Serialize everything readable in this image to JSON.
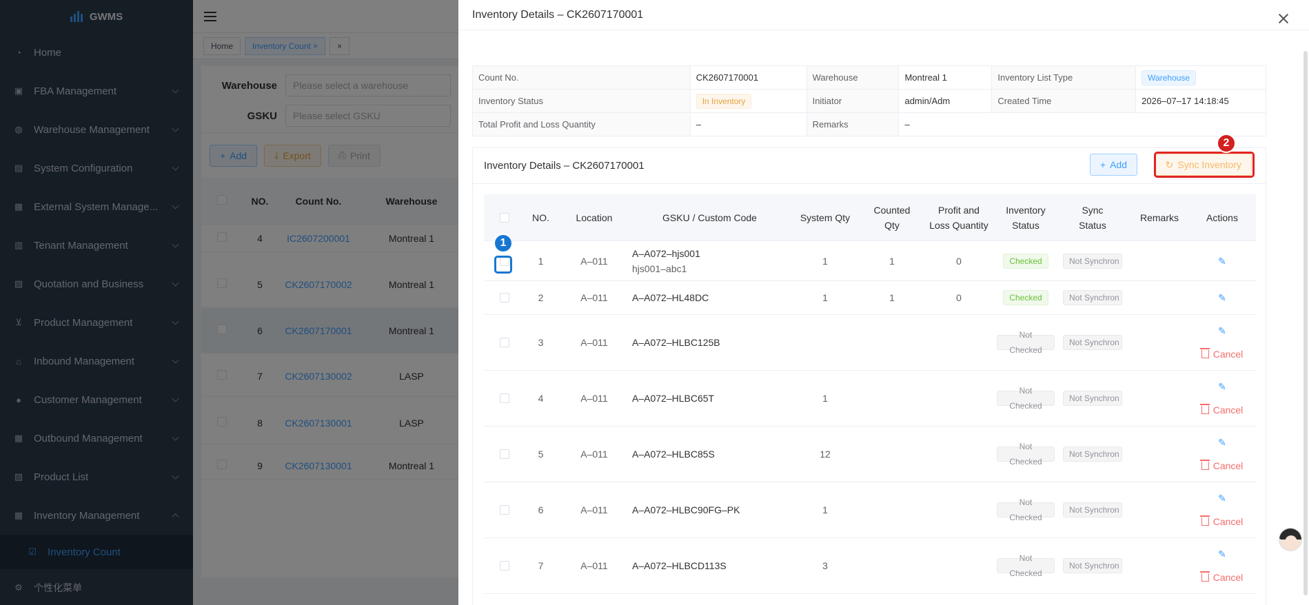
{
  "app": {
    "name": "GWMS"
  },
  "sidebar": {
    "items": [
      {
        "label": "Home",
        "icon": "gauge-icon"
      },
      {
        "label": "FBA Management",
        "icon": "box-icon"
      },
      {
        "label": "Warehouse Management",
        "icon": "globe-icon"
      },
      {
        "label": "System Configuration",
        "icon": "document-icon"
      },
      {
        "label": "External System Manage...",
        "icon": "grid-icon"
      },
      {
        "label": "Tenant Management",
        "icon": "bar-chart-icon"
      },
      {
        "label": "Quotation and Business",
        "icon": "receipt-icon"
      },
      {
        "label": "Product Management",
        "icon": "cart-icon"
      },
      {
        "label": "Inbound Management",
        "icon": "home-icon"
      },
      {
        "label": "Customer Management",
        "icon": "user-icon"
      },
      {
        "label": "Outbound Management",
        "icon": "grid-icon"
      },
      {
        "label": "Product List",
        "icon": "book-icon"
      },
      {
        "label": "Inventory Management",
        "icon": "table-icon"
      }
    ],
    "sub_item": "Inventory Count",
    "custom_menu": "个性化菜单"
  },
  "tags": {
    "home": "Home",
    "inventory_count": "Inventory Count"
  },
  "filters": {
    "warehouse_label": "Warehouse",
    "warehouse_placeholder": "Please select a warehouse",
    "gsku_label": "GSKU",
    "gsku_placeholder": "Please select GSKU"
  },
  "toolbar": {
    "add": "Add",
    "export": "Export",
    "print": "Print"
  },
  "bg_table": {
    "headers": [
      "NO.",
      "Count No.",
      "Warehouse"
    ],
    "rows": [
      {
        "no": "4",
        "count_no": "IC2607200001",
        "warehouse": "Montreal 1"
      },
      {
        "no": "5",
        "count_no": "CK2607170002",
        "warehouse": "Montreal 1"
      },
      {
        "no": "6",
        "count_no": "CK2607170001",
        "warehouse": "Montreal 1"
      },
      {
        "no": "7",
        "count_no": "CK2607130002",
        "warehouse": "LASP"
      },
      {
        "no": "8",
        "count_no": "CK2607130001",
        "warehouse": "LASP"
      },
      {
        "no": "9",
        "count_no": "CK2607130001",
        "warehouse": "Montreal 1"
      }
    ]
  },
  "drawer": {
    "title": "Inventory Details – CK2607170001",
    "desc": {
      "count_no_label": "Count No.",
      "count_no": "CK2607170001",
      "warehouse_label": "Warehouse",
      "warehouse": "Montreal 1",
      "list_type_label": "Inventory List Type",
      "list_type": "Warehouse",
      "status_label": "Inventory Status",
      "status": "In Inventory",
      "initiator_label": "Initiator",
      "initiator": "admin/Adm",
      "created_label": "Created Time",
      "created": "2026–07–17 14:18:45",
      "total_label": "Total Profit and Loss Quantity",
      "total": "–",
      "remarks_label": "Remarks",
      "remarks": "–"
    },
    "card_title": "Inventory Details – CK2607170001",
    "add_btn": "Add",
    "sync_btn": "Sync Inventory",
    "columns": {
      "no": "NO.",
      "location": "Location",
      "gsku": "GSKU / Custom Code",
      "system_qty": "System Qty",
      "counted_qty": "Counted Qty",
      "profit_loss": "Profit and Loss Quantity",
      "inv_status": "Inventory Status",
      "sync_status": "Sync Status",
      "remarks": "Remarks",
      "actions": "Actions"
    },
    "cancel_label": "Cancel",
    "rows": [
      {
        "no": "1",
        "location": "A–011",
        "gsku": "A–A072–hjs001",
        "custom": "hjs001–abc1",
        "system_qty": "1",
        "counted_qty": "1",
        "pl": "0",
        "inv_status": "Checked",
        "sync_status": "Not Synchron"
      },
      {
        "no": "2",
        "location": "A–011",
        "gsku": "A–A072–HL48DC",
        "custom": "",
        "system_qty": "1",
        "counted_qty": "1",
        "pl": "0",
        "inv_status": "Checked",
        "sync_status": "Not Synchron"
      },
      {
        "no": "3",
        "location": "A–011",
        "gsku": "A–A072–HLBC125B",
        "custom": "",
        "system_qty": "",
        "counted_qty": "",
        "pl": "",
        "inv_status": "Not Checked",
        "sync_status": "Not Synchron"
      },
      {
        "no": "4",
        "location": "A–011",
        "gsku": "A–A072–HLBC65T",
        "custom": "",
        "system_qty": "1",
        "counted_qty": "",
        "pl": "",
        "inv_status": "Not Checked",
        "sync_status": "Not Synchron"
      },
      {
        "no": "5",
        "location": "A–011",
        "gsku": "A–A072–HLBC85S",
        "custom": "",
        "system_qty": "12",
        "counted_qty": "",
        "pl": "",
        "inv_status": "Not Checked",
        "sync_status": "Not Synchron"
      },
      {
        "no": "6",
        "location": "A–011",
        "gsku": "A–A072–HLBC90FG–PK",
        "custom": "",
        "system_qty": "1",
        "counted_qty": "",
        "pl": "",
        "inv_status": "Not Checked",
        "sync_status": "Not Synchron"
      },
      {
        "no": "7",
        "location": "A–011",
        "gsku": "A–A072–HLBCD113S",
        "custom": "",
        "system_qty": "3",
        "counted_qty": "",
        "pl": "",
        "inv_status": "Not Checked",
        "sync_status": "Not Synchron"
      }
    ]
  },
  "annotations": {
    "badge1": "1",
    "badge2": "2"
  }
}
